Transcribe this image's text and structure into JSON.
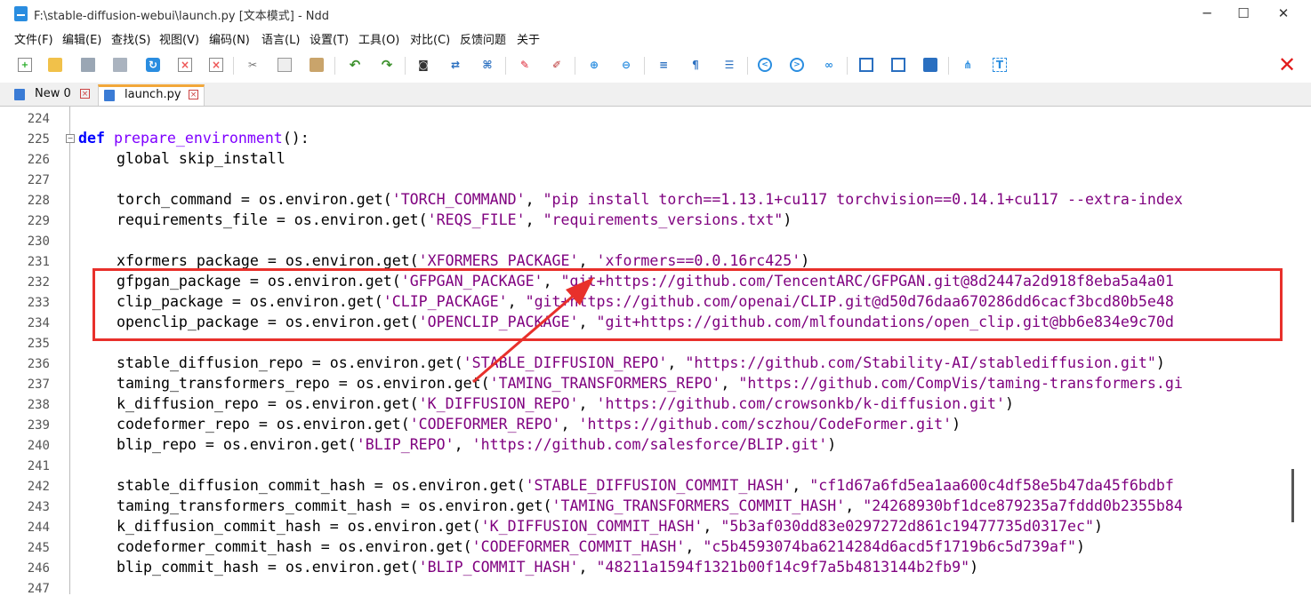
{
  "window": {
    "title": "F:\\stable-diffusion-webui\\launch.py [文本模式] - Ndd",
    "minimize_glyph": "─",
    "maximize_glyph": "☐",
    "close_glyph": "✕"
  },
  "menu": [
    "文件(F)",
    "编辑(E)",
    "查找(S)",
    "视图(V)",
    "编码(N)",
    "语言(L)",
    "设置(T)",
    "工具(O)",
    "对比(C)",
    "反馈问题",
    "关于"
  ],
  "toolbar": {
    "icons": [
      "new-file-icon",
      "open-file-icon",
      "save-icon",
      "save-all-icon",
      "reload-icon",
      "close-file-icon",
      "close-all-icon",
      "cut-icon",
      "copy-icon",
      "paste-icon",
      "undo-icon",
      "redo-icon",
      "find-icon",
      "replace-icon",
      "mark-icon",
      "highlight-icon",
      "clear-mark-icon",
      "zoom-in-icon",
      "zoom-out-icon",
      "word-wrap-icon",
      "show-symbols-icon",
      "indent-guide-icon",
      "prev-icon",
      "next-icon",
      "bookmark-icon",
      "compare-dir-icon",
      "compare-file-icon",
      "binary-compare-icon",
      "tree-icon",
      "text-mode-icon"
    ],
    "close_doc_glyph": "✕",
    "accent_red": "#e21b1b"
  },
  "tabs": [
    {
      "label": "New 0",
      "active": false
    },
    {
      "label": "launch.py",
      "active": true
    }
  ],
  "editor": {
    "lines": [
      {
        "n": "224",
        "text": ""
      },
      {
        "n": "225",
        "text": "def prepare_environment():"
      },
      {
        "n": "226",
        "text": "    global skip_install"
      },
      {
        "n": "227",
        "text": ""
      },
      {
        "n": "228",
        "text": "    torch_command = os.environ.get('TORCH_COMMAND', \"pip install torch==1.13.1+cu117 torchvision==0.14.1+cu117 --extra-index"
      },
      {
        "n": "229",
        "text": "    requirements_file = os.environ.get('REQS_FILE', \"requirements_versions.txt\")"
      },
      {
        "n": "230",
        "text": ""
      },
      {
        "n": "231",
        "text": "    xformers_package = os.environ.get('XFORMERS_PACKAGE', 'xformers==0.0.16rc425')"
      },
      {
        "n": "232",
        "text": "    gfpgan_package = os.environ.get('GFPGAN_PACKAGE', \"git+https://github.com/TencentARC/GFPGAN.git@8d2447a2d918f8eba5a4a01"
      },
      {
        "n": "233",
        "text": "    clip_package = os.environ.get('CLIP_PACKAGE', \"git+https://github.com/openai/CLIP.git@d50d76daa670286dd6cacf3bcd80b5e48"
      },
      {
        "n": "234",
        "text": "    openclip_package = os.environ.get('OPENCLIP_PACKAGE', \"git+https://github.com/mlfoundations/open_clip.git@bb6e834e9c70d"
      },
      {
        "n": "235",
        "text": ""
      },
      {
        "n": "236",
        "text": "    stable_diffusion_repo = os.environ.get('STABLE_DIFFUSION_REPO', \"https://github.com/Stability-AI/stablediffusion.git\")"
      },
      {
        "n": "237",
        "text": "    taming_transformers_repo = os.environ.get('TAMING_TRANSFORMERS_REPO', \"https://github.com/CompVis/taming-transformers.gi"
      },
      {
        "n": "238",
        "text": "    k_diffusion_repo = os.environ.get('K_DIFFUSION_REPO', 'https://github.com/crowsonkb/k-diffusion.git')"
      },
      {
        "n": "239",
        "text": "    codeformer_repo = os.environ.get('CODEFORMER_REPO', 'https://github.com/sczhou/CodeFormer.git')"
      },
      {
        "n": "240",
        "text": "    blip_repo = os.environ.get('BLIP_REPO', 'https://github.com/salesforce/BLIP.git')"
      },
      {
        "n": "241",
        "text": ""
      },
      {
        "n": "242",
        "text": "    stable_diffusion_commit_hash = os.environ.get('STABLE_DIFFUSION_COMMIT_HASH', \"cf1d67a6fd5ea1aa600c4df58e5b47da45f6bdbf"
      },
      {
        "n": "243",
        "text": "    taming_transformers_commit_hash = os.environ.get('TAMING_TRANSFORMERS_COMMIT_HASH', \"24268930bf1dce879235a7fddd0b2355b84"
      },
      {
        "n": "244",
        "text": "    k_diffusion_commit_hash = os.environ.get('K_DIFFUSION_COMMIT_HASH', \"5b3af030dd83e0297272d861c19477735d0317ec\")"
      },
      {
        "n": "245",
        "text": "    codeformer_commit_hash = os.environ.get('CODEFORMER_COMMIT_HASH', \"c5b4593074ba6214284d6acd5f1719b6c5d739af\")"
      },
      {
        "n": "246",
        "text": "    blip_commit_hash = os.environ.get('BLIP_COMMIT_HASH', \"48211a1594f1321b00f14c9f7a5b4813144b2fb9\")"
      },
      {
        "n": "247",
        "text": ""
      }
    ],
    "highlight_color": "#e8302b"
  }
}
